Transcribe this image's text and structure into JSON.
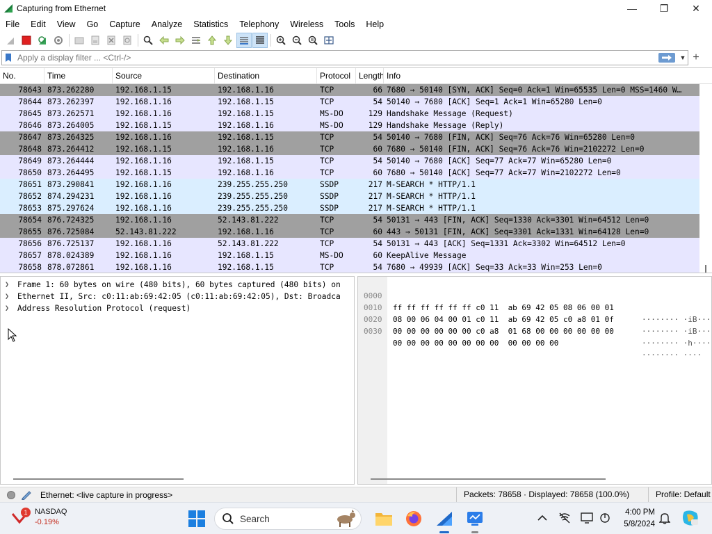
{
  "window": {
    "title": "Capturing from Ethernet",
    "controls": {
      "minimize": "—",
      "maximize": "❐",
      "close": "✕"
    }
  },
  "menu": [
    "File",
    "Edit",
    "View",
    "Go",
    "Capture",
    "Analyze",
    "Statistics",
    "Telephony",
    "Wireless",
    "Tools",
    "Help"
  ],
  "toolbar": {
    "icons": [
      "start-capture-icon",
      "stop-capture-icon",
      "restart-capture-icon",
      "capture-options-icon",
      "open-file-icon",
      "save-file-icon",
      "close-file-icon",
      "reload-file-icon",
      "find-packet-icon",
      "go-back-icon",
      "go-forward-icon",
      "go-to-packet-icon",
      "go-first-icon",
      "go-last-icon",
      "auto-scroll-icon",
      "colorize-icon",
      "zoom-in-icon",
      "zoom-out-icon",
      "normal-size-icon",
      "resize-columns-icon"
    ],
    "active": [
      "auto-scroll-icon",
      "colorize-icon"
    ]
  },
  "filter": {
    "placeholder": "Apply a display filter ... <Ctrl-/>",
    "value": "",
    "add_label": "+"
  },
  "packet_list": {
    "columns": [
      "No.",
      "Time",
      "Source",
      "Destination",
      "Protocol",
      "Length",
      "Info"
    ],
    "rows": [
      {
        "no": "78643",
        "time": "873.262280",
        "src": "192.168.1.15",
        "dst": "192.168.1.16",
        "proto": "TCP",
        "len": "66",
        "info": "7680 → 50140 [SYN, ACK] Seq=0 Ack=1 Win=65535 Len=0 MSS=1460 W…",
        "bg": "#a0a0a0"
      },
      {
        "no": "78644",
        "time": "873.262397",
        "src": "192.168.1.16",
        "dst": "192.168.1.15",
        "proto": "TCP",
        "len": "54",
        "info": "50140 → 7680 [ACK] Seq=1 Ack=1 Win=65280 Len=0",
        "bg": "#e7e6ff"
      },
      {
        "no": "78645",
        "time": "873.262571",
        "src": "192.168.1.16",
        "dst": "192.168.1.15",
        "proto": "MS-DO",
        "len": "129",
        "info": "Handshake Message (Request)",
        "bg": "#e7e6ff"
      },
      {
        "no": "78646",
        "time": "873.264005",
        "src": "192.168.1.15",
        "dst": "192.168.1.16",
        "proto": "MS-DO",
        "len": "129",
        "info": "Handshake Message (Reply)",
        "bg": "#e7e6ff"
      },
      {
        "no": "78647",
        "time": "873.264325",
        "src": "192.168.1.16",
        "dst": "192.168.1.15",
        "proto": "TCP",
        "len": "54",
        "info": "50140 → 7680 [FIN, ACK] Seq=76 Ack=76 Win=65280 Len=0",
        "bg": "#a0a0a0"
      },
      {
        "no": "78648",
        "time": "873.264412",
        "src": "192.168.1.15",
        "dst": "192.168.1.16",
        "proto": "TCP",
        "len": "60",
        "info": "7680 → 50140 [FIN, ACK] Seq=76 Ack=76 Win=2102272 Len=0",
        "bg": "#a0a0a0"
      },
      {
        "no": "78649",
        "time": "873.264444",
        "src": "192.168.1.16",
        "dst": "192.168.1.15",
        "proto": "TCP",
        "len": "54",
        "info": "50140 → 7680 [ACK] Seq=77 Ack=77 Win=65280 Len=0",
        "bg": "#e7e6ff"
      },
      {
        "no": "78650",
        "time": "873.264495",
        "src": "192.168.1.15",
        "dst": "192.168.1.16",
        "proto": "TCP",
        "len": "60",
        "info": "7680 → 50140 [ACK] Seq=77 Ack=77 Win=2102272 Len=0",
        "bg": "#e7e6ff"
      },
      {
        "no": "78651",
        "time": "873.290841",
        "src": "192.168.1.16",
        "dst": "239.255.255.250",
        "proto": "SSDP",
        "len": "217",
        "info": "M-SEARCH * HTTP/1.1",
        "bg": "#daeeff"
      },
      {
        "no": "78652",
        "time": "874.294231",
        "src": "192.168.1.16",
        "dst": "239.255.255.250",
        "proto": "SSDP",
        "len": "217",
        "info": "M-SEARCH * HTTP/1.1",
        "bg": "#daeeff"
      },
      {
        "no": "78653",
        "time": "875.297624",
        "src": "192.168.1.16",
        "dst": "239.255.255.250",
        "proto": "SSDP",
        "len": "217",
        "info": "M-SEARCH * HTTP/1.1",
        "bg": "#daeeff"
      },
      {
        "no": "78654",
        "time": "876.724325",
        "src": "192.168.1.16",
        "dst": "52.143.81.222",
        "proto": "TCP",
        "len": "54",
        "info": "50131 → 443 [FIN, ACK] Seq=1330 Ack=3301 Win=64512 Len=0",
        "bg": "#a0a0a0"
      },
      {
        "no": "78655",
        "time": "876.725084",
        "src": "52.143.81.222",
        "dst": "192.168.1.16",
        "proto": "TCP",
        "len": "60",
        "info": "443 → 50131 [FIN, ACK] Seq=3301 Ack=1331 Win=64128 Len=0",
        "bg": "#a0a0a0"
      },
      {
        "no": "78656",
        "time": "876.725137",
        "src": "192.168.1.16",
        "dst": "52.143.81.222",
        "proto": "TCP",
        "len": "54",
        "info": "50131 → 443 [ACK] Seq=1331 Ack=3302 Win=64512 Len=0",
        "bg": "#e7e6ff"
      },
      {
        "no": "78657",
        "time": "878.024389",
        "src": "192.168.1.16",
        "dst": "192.168.1.15",
        "proto": "MS-DO",
        "len": "60",
        "info": "KeepAlive Message",
        "bg": "#e7e6ff"
      },
      {
        "no": "78658",
        "time": "878.072861",
        "src": "192.168.1.16",
        "dst": "192.168.1.15",
        "proto": "TCP",
        "len": "54",
        "info": "7680 → 49939 [ACK] Seq=33 Ack=33 Win=253 Len=0",
        "bg": "#e7e6ff"
      }
    ]
  },
  "details": {
    "rows": [
      "Frame 1: 60 bytes on wire (480 bits), 60 bytes captured (480 bits) on",
      "Ethernet II, Src: c0:11:ab:69:42:05 (c0:11:ab:69:42:05), Dst: Broadca",
      "Address Resolution Protocol (request)"
    ]
  },
  "bytes": {
    "rows": [
      {
        "offset": "0000",
        "hex": "ff ff ff ff ff ff c0 11  ab 69 42 05 08 06 00 01",
        "ascii": "········ ·iB·····"
      },
      {
        "offset": "0010",
        "hex": "08 00 06 04 00 01 c0 11  ab 69 42 05 c0 a8 01 0f",
        "ascii": "········ ·iB·····"
      },
      {
        "offset": "0020",
        "hex": "00 00 00 00 00 00 c0 a8  01 68 00 00 00 00 00 00",
        "ascii": "········ ·h······"
      },
      {
        "offset": "0030",
        "hex": "00 00 00 00 00 00 00 00  00 00 00 00",
        "ascii": "········ ····"
      }
    ]
  },
  "status": {
    "capture_text": "Ethernet: <live capture in progress>",
    "packets_text": "Packets: 78658 · Displayed: 78658 (100.0%)",
    "profile_text": "Profile: Default"
  },
  "taskbar": {
    "stock": {
      "name": "NASDAQ",
      "change": "-0.19%",
      "badge": "1"
    },
    "search_label": "Search",
    "apps": [
      "file-explorer-icon",
      "firefox-icon",
      "wireshark-icon",
      "network-app-icon"
    ],
    "clock": {
      "time": "4:00 PM",
      "date": "5/8/2024"
    }
  },
  "colors": {
    "tcp_gray": "#a0a0a0",
    "tcp_lavender": "#e7e6ff",
    "ssdp_blue": "#daeeff",
    "stop_red": "#e02020"
  }
}
